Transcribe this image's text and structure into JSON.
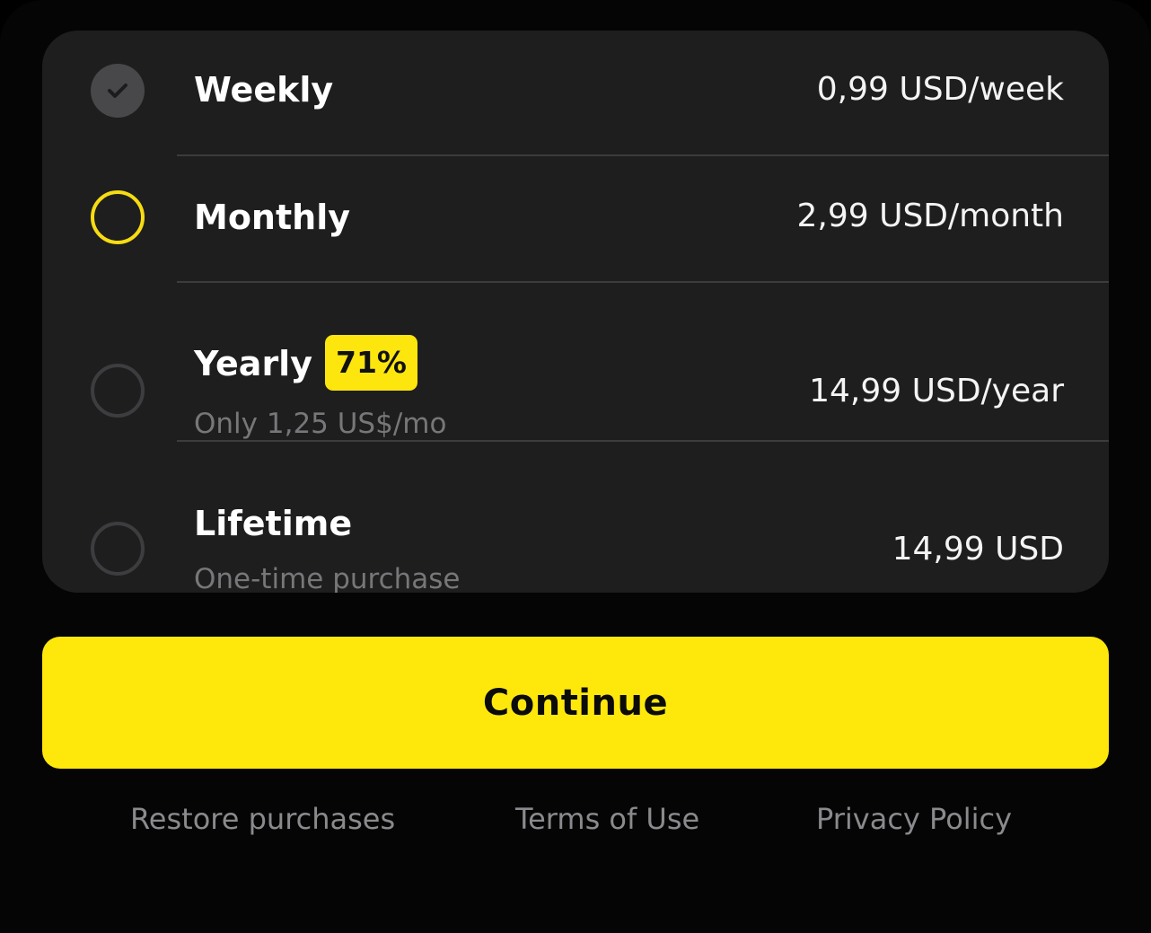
{
  "plans": [
    {
      "name": "Weekly",
      "price": "0,99 USD/week",
      "subtitle": "",
      "badge": "",
      "state": "checked"
    },
    {
      "name": "Monthly",
      "price": "2,99 USD/month",
      "subtitle": "",
      "badge": "",
      "state": "selected"
    },
    {
      "name": "Yearly",
      "price": "14,99 USD/year",
      "subtitle": "Only 1,25 US$/mo",
      "badge": "71%",
      "state": "unselected"
    },
    {
      "name": "Lifetime",
      "price": "14,99 USD",
      "subtitle": "One-time purchase",
      "badge": "",
      "state": "unselected"
    }
  ],
  "continue_label": "Continue",
  "footer": {
    "restore": "Restore purchases",
    "terms": "Terms of Use",
    "privacy": "Privacy Policy"
  },
  "icons": {
    "checked_radio": "checkmark-icon",
    "selected_radio": "radio-selected-icon",
    "unselected_radio": "radio-unselected-icon"
  },
  "colors": {
    "accent": "#FEE80C",
    "card_background": "#1E1E1F",
    "page_background": "#000000",
    "muted_text": "#77777A",
    "badge_background": "#FDE60D"
  }
}
